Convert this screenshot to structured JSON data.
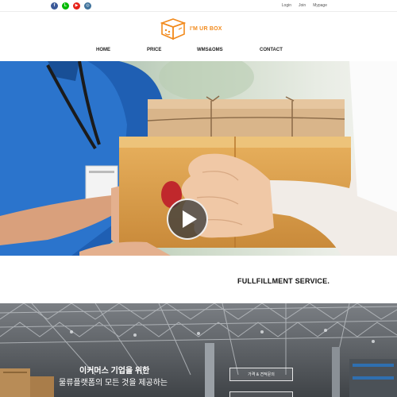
{
  "topbar": {
    "social": [
      {
        "icon": "facebook-icon",
        "glyph": "f",
        "color": "#3b5998"
      },
      {
        "icon": "line-icon",
        "glyph": "L",
        "color": "#00b900"
      },
      {
        "icon": "youtube-icon",
        "glyph": "▶",
        "color": "#e62117"
      },
      {
        "icon": "instagram-icon",
        "glyph": "◎",
        "color": "#3f729b"
      }
    ],
    "login": "Login",
    "join": "Join",
    "mypage": "Mypage"
  },
  "logo": {
    "text": "I'M UR BOX",
    "brand_color": "#f28a1c"
  },
  "nav": {
    "items": [
      "HOME",
      "PRICE",
      "WMS&OMS",
      "CONTACT"
    ]
  },
  "hero": {
    "play_icon": "play-icon"
  },
  "fulfillment": {
    "title": "FULLFILLMENT SERVICE."
  },
  "warehouse": {
    "title": "이커머스 기업을 위한",
    "subtitle": "물류플랫폼의 모든 것을 제공하는",
    "button1": "가격 & 견적문의",
    "button2": ""
  }
}
